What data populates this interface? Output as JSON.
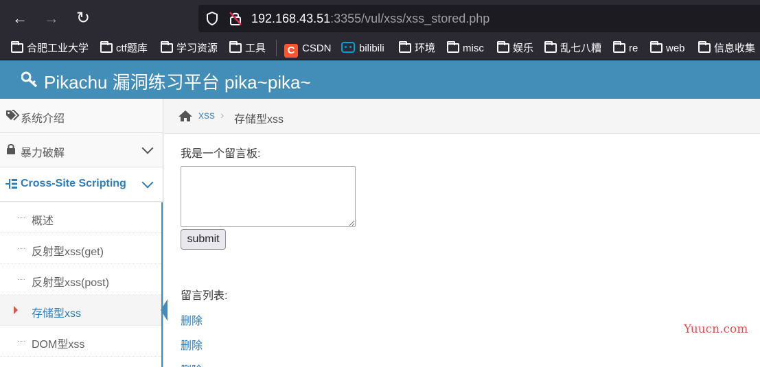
{
  "browser": {
    "url_host": "192.168.43.51",
    "url_rest": ":3355/vul/xss/xss_stored.php",
    "bookmarks": [
      "合肥工业大学",
      "ctf题库",
      "学习资源",
      "工具",
      "CSDN",
      "bilibili",
      "环境",
      "misc",
      "娱乐",
      "乱七八糟",
      "re",
      "web",
      "信息收集"
    ]
  },
  "header": {
    "title": "Pikachu 漏洞练习平台 pika~pika~"
  },
  "sidebar": {
    "items": [
      {
        "label": "系统介绍"
      },
      {
        "label": "暴力破解"
      },
      {
        "label": "Cross-Site Scripting"
      }
    ],
    "sub_items": [
      {
        "label": "概述"
      },
      {
        "label": "反射型xss(get)"
      },
      {
        "label": "反射型xss(post)"
      },
      {
        "label": "存储型xss"
      },
      {
        "label": "DOM型xss"
      }
    ]
  },
  "breadcrumb": {
    "parent": "xss",
    "current": "存储型xss"
  },
  "main": {
    "board_label": "我是一个留言板:",
    "submit_label": "submit",
    "list_label": "留言列表:",
    "delete_links": [
      "删除",
      "删除",
      "删除"
    ]
  },
  "watermark": "Yuucn.com"
}
